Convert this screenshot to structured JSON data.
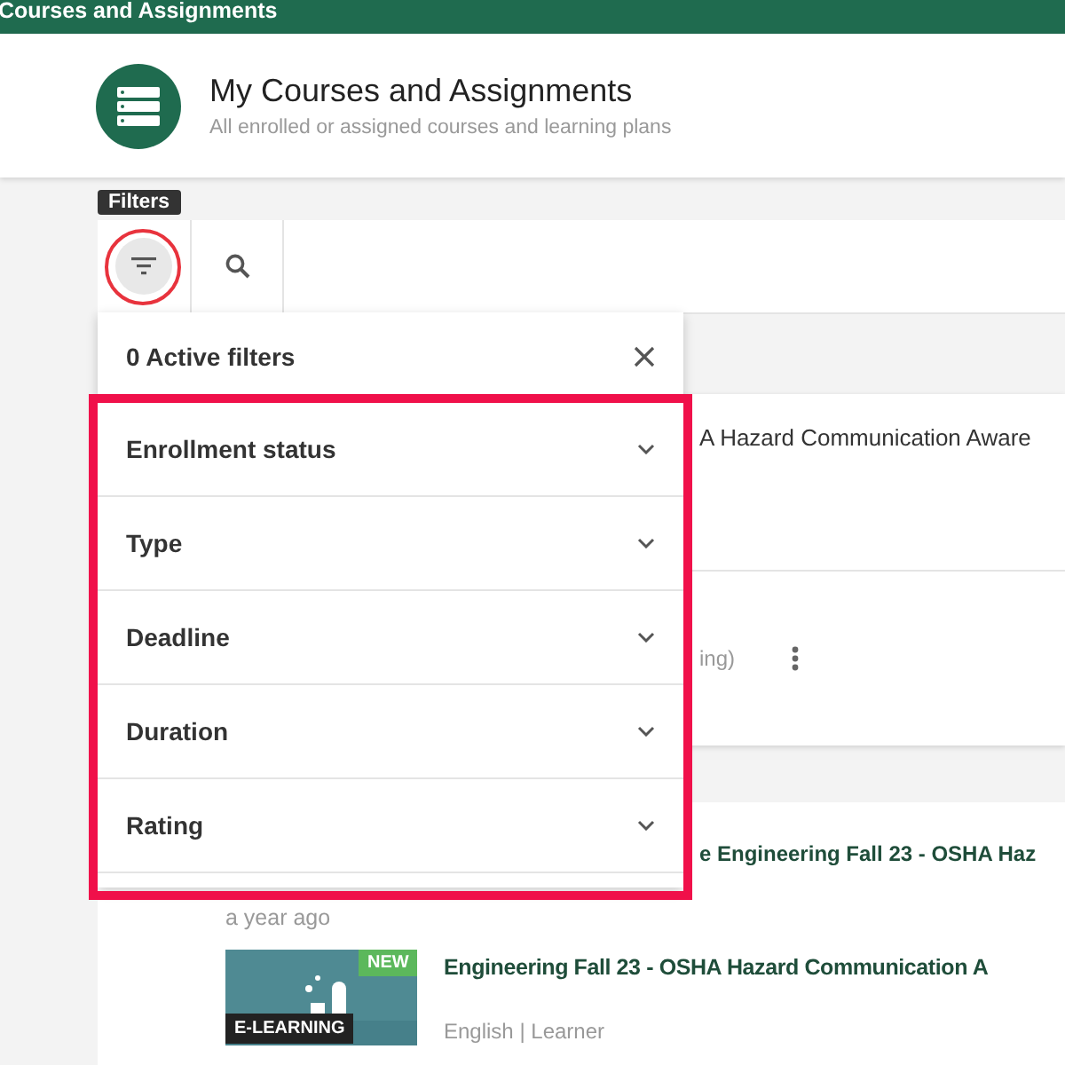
{
  "app_bar": {
    "title": "Courses and Assignments"
  },
  "header": {
    "title": "My Courses and Assignments",
    "subtitle": "All enrolled or assigned courses and learning plans"
  },
  "toolbar": {
    "tooltip": "Filters",
    "filter_button": {
      "selected": true
    }
  },
  "filter_panel": {
    "active_count": "0 Active filters",
    "sections": [
      {
        "label": "Enrollment status",
        "expanded": false
      },
      {
        "label": "Type",
        "expanded": false
      },
      {
        "label": "Deadline",
        "expanded": false
      },
      {
        "label": "Duration",
        "expanded": false
      },
      {
        "label": "Rating",
        "expanded": false
      }
    ]
  },
  "background_card": {
    "title": "A Hazard Communication Aware",
    "meta": "ing)"
  },
  "activity": {
    "title": "e Engineering Fall 23 - OSHA Haz",
    "time": "a year ago",
    "course": {
      "badge": "NEW",
      "type": "E-LEARNING",
      "title": "Engineering Fall 23 - OSHA Hazard Communication A",
      "meta": "English | Learner"
    }
  }
}
